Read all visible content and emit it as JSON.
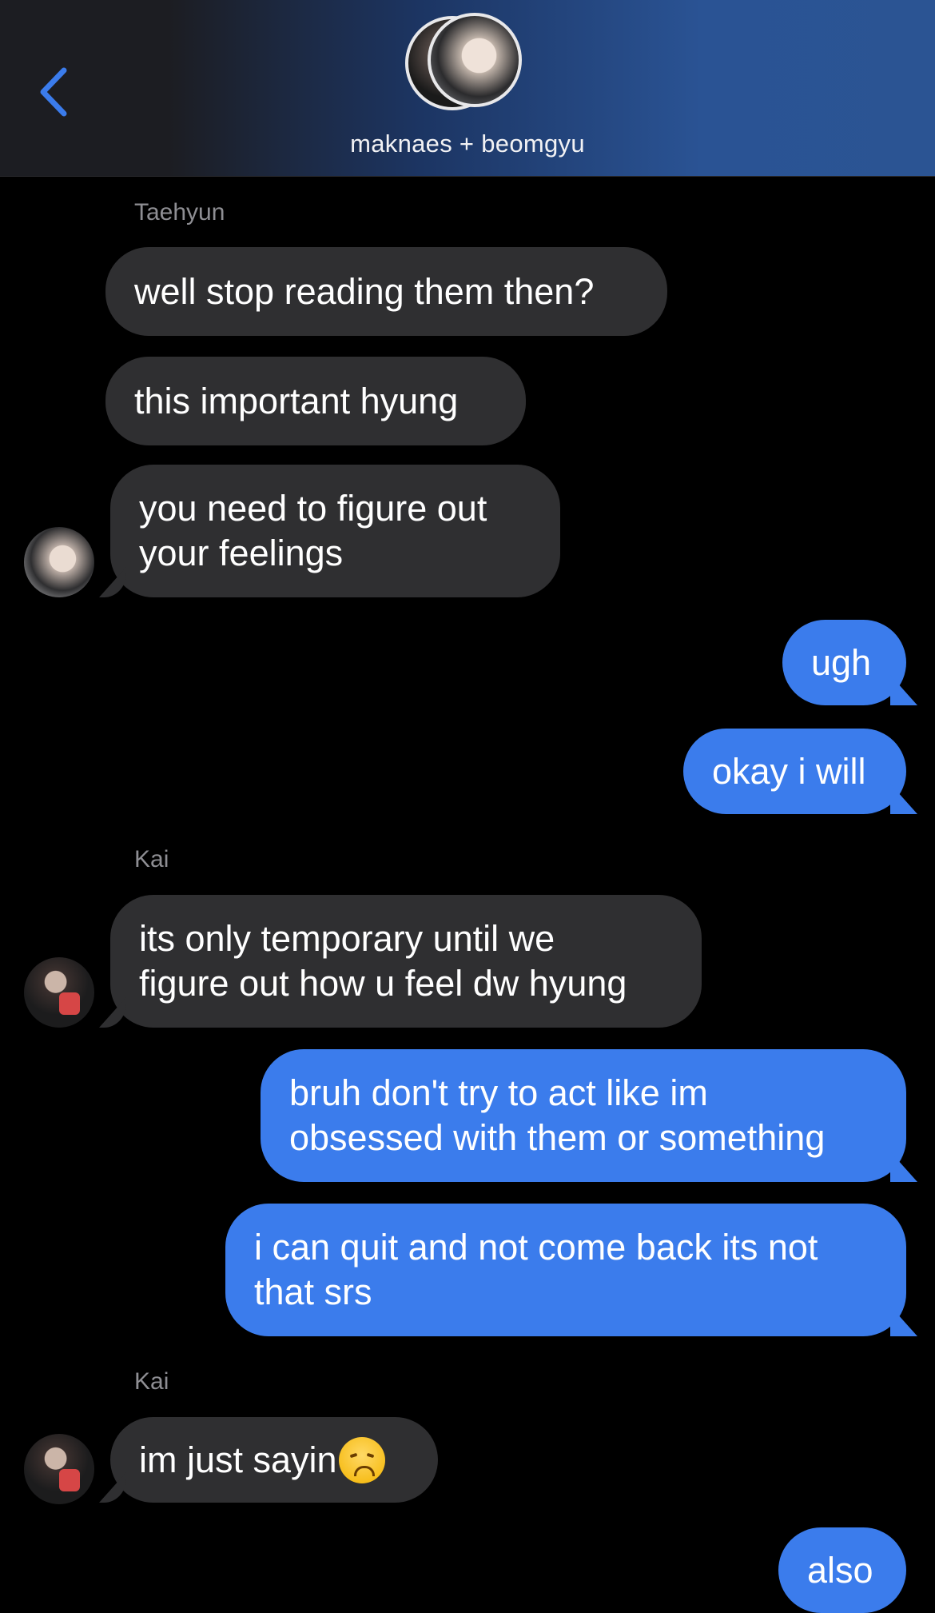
{
  "header": {
    "group_name": "maknaes + beomgyu",
    "back_icon": "chevron-left-icon",
    "accent_color": "#3b7cec"
  },
  "messages": [
    {
      "type": "sender",
      "text": "Taehyun"
    },
    {
      "type": "in",
      "text": "well stop reading them then?"
    },
    {
      "type": "in",
      "text": "this important hyung"
    },
    {
      "type": "in",
      "text": "you need to figure out\nyour feelings"
    },
    {
      "type": "out",
      "text": "ugh"
    },
    {
      "type": "out",
      "text": "okay i will"
    },
    {
      "type": "sender",
      "text": "Kai"
    },
    {
      "type": "in",
      "text": "its only temporary until we\nfigure out how u feel dw hyung"
    },
    {
      "type": "out",
      "text": "bruh don't try to act like im\nobsessed with them or something"
    },
    {
      "type": "out",
      "text": "i can quit and not come back its not\nthat srs"
    },
    {
      "type": "sender",
      "text": "Kai"
    },
    {
      "type": "in",
      "text": "im just sayin",
      "emoji": "disappointed-face-emoji"
    },
    {
      "type": "out",
      "text": "also"
    }
  ],
  "colors": {
    "incoming_bubble": "#2f2f31",
    "outgoing_bubble": "#3b7cec",
    "background": "#000000"
  }
}
